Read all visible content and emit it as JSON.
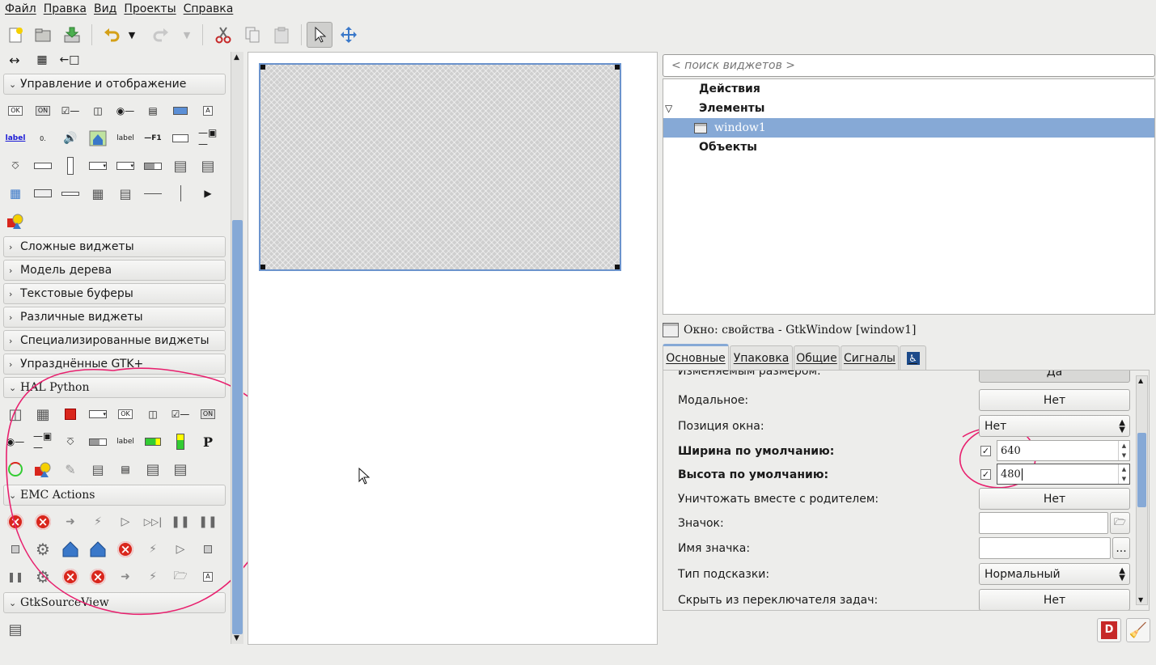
{
  "menu": [
    "Файл",
    "Правка",
    "Вид",
    "Проекты",
    "Справка"
  ],
  "palette": {
    "groups": [
      {
        "label": "Управление и отображение",
        "expanded": true
      },
      {
        "label": "Сложные виджеты",
        "expanded": false
      },
      {
        "label": "Модель дерева",
        "expanded": false
      },
      {
        "label": "Текстовые буферы",
        "expanded": false
      },
      {
        "label": "Различные виджеты",
        "expanded": false
      },
      {
        "label": "Специализированные виджеты",
        "expanded": false
      },
      {
        "label": "Упразднённые GTK+",
        "expanded": false
      },
      {
        "label": "HAL Python",
        "expanded": true
      },
      {
        "label": "EMC Actions",
        "expanded": true
      },
      {
        "label": "GtkSourceView",
        "expanded": true
      }
    ],
    "mini_labels": {
      "ok": "OK",
      "on": "ON",
      "label": "label",
      "f1": "F1",
      "zero": "0.",
      "a": "A",
      "p": "P"
    }
  },
  "search": {
    "placeholder": "< поиск виджетов >"
  },
  "tree": {
    "actions": "Действия",
    "elements": "Элементы",
    "window": "window1",
    "objects": "Объекты"
  },
  "properties": {
    "title": "Окно: свойства - GtkWindow [window1]",
    "tabs": [
      "Основные",
      "Упаковка",
      "Общие",
      "Сигналы"
    ],
    "rows": {
      "resizable": {
        "label": "Изменяемым размером:",
        "value": "Да"
      },
      "modal": {
        "label": "Модальное:",
        "value": "Нет"
      },
      "position": {
        "label": "Позиция окна:",
        "value": "Нет"
      },
      "width": {
        "label": "Ширина по умолчанию:",
        "value": "640"
      },
      "height": {
        "label": "Высота по умолчанию:",
        "value": "480"
      },
      "destroy": {
        "label": "Уничтожать вместе с родителем:",
        "value": "Нет"
      },
      "icon": {
        "label": "Значок:",
        "value": ""
      },
      "icon_name": {
        "label": "Имя значка:",
        "value": "",
        "button": "..."
      },
      "hint": {
        "label": "Тип подсказки:",
        "value": "Нормальный"
      },
      "skip": {
        "label": "Скрыть из переключателя задач:",
        "value": "Нет"
      }
    }
  },
  "colors": {
    "selection": "#86a9d6",
    "annotation": "#e8206e",
    "error_red": "#d9261c"
  }
}
